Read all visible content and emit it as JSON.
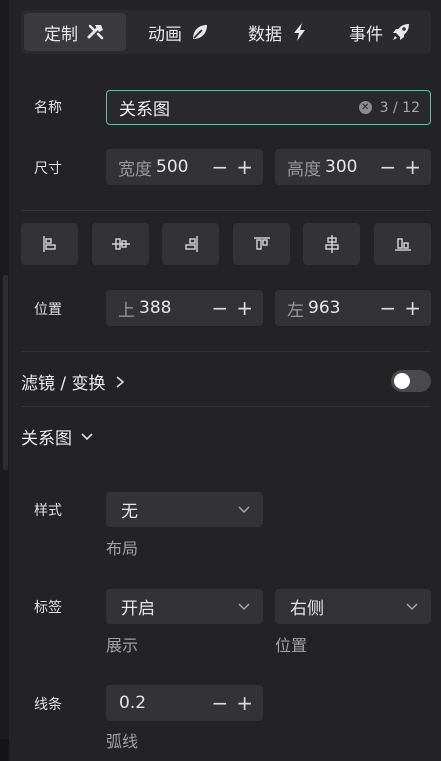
{
  "tabs": [
    {
      "label": "定制",
      "icon": "tools-icon",
      "active": true
    },
    {
      "label": "动画",
      "icon": "leaf-icon",
      "active": false
    },
    {
      "label": "数据",
      "icon": "lightning-icon",
      "active": false
    },
    {
      "label": "事件",
      "icon": "rocket-icon",
      "active": false
    }
  ],
  "name": {
    "label": "名称",
    "value": "关系图",
    "count": "3 / 12"
  },
  "size": {
    "label": "尺寸",
    "width_prefix": "宽度",
    "width": "500",
    "height_prefix": "高度",
    "height": "300"
  },
  "alignment": {
    "icons": [
      "align-left-icon",
      "align-center-horizontal-icon",
      "align-right-icon",
      "align-top-icon",
      "align-center-vertical-icon",
      "align-bottom-icon"
    ]
  },
  "position": {
    "label": "位置",
    "top_prefix": "上",
    "top": "388",
    "left_prefix": "左",
    "left": "963"
  },
  "stepper": {
    "minus": "−",
    "plus": "+"
  },
  "filter_section": {
    "title": "滤镜 / 变换",
    "enabled": false
  },
  "graph_section": {
    "title": "关系图"
  },
  "style": {
    "label": "样式",
    "layout_value": "无",
    "layout_caption": "布局"
  },
  "tags": {
    "label": "标签",
    "show_value": "开启",
    "show_caption": "展示",
    "position_value": "右侧",
    "position_caption": "位置"
  },
  "line": {
    "label": "线条",
    "curve_value": "0.2",
    "curve_caption": "弧线"
  },
  "colors": {
    "accent": "#5fc0a8",
    "panel": "#232325",
    "field": "#333336"
  }
}
